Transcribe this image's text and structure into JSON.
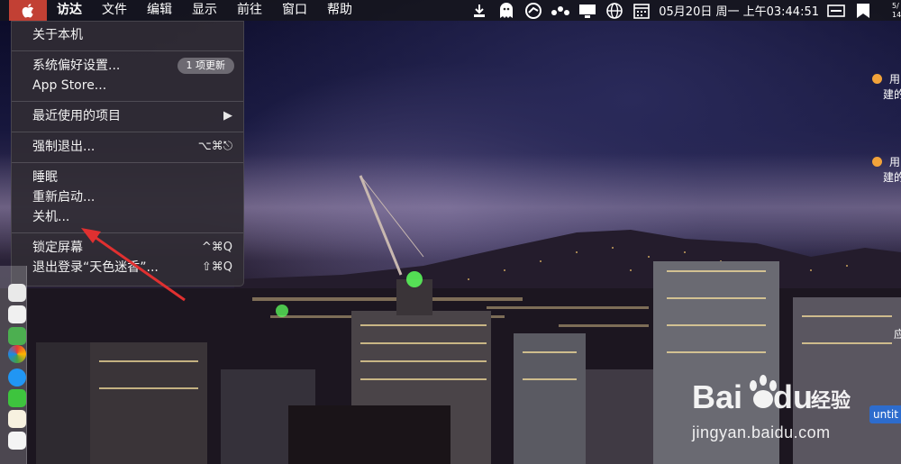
{
  "menubar": {
    "apple_icon": "apple-logo-icon",
    "items": [
      "访达",
      "文件",
      "编辑",
      "显示",
      "前往",
      "窗口",
      "帮助"
    ],
    "status_icons": [
      "download-icon",
      "ghost-icon",
      "sync-icon",
      "dots-icon",
      "display-icon",
      "globe-icon",
      "calendar-icon"
    ],
    "clock": "05月20日 周一 上午03:44:51",
    "trailing_icons": [
      "menu-bars-icon",
      "app-icon"
    ]
  },
  "apple_menu": {
    "about": "关于本机",
    "system_prefs": "系统偏好设置...",
    "system_prefs_badge": "1 项更新",
    "app_store": "App Store...",
    "recent_items": "最近使用的项目",
    "recent_items_arrow": "▶",
    "force_quit": "强制退出...",
    "force_quit_shortcut": "⌥⌘⎋",
    "sleep": "睡眠",
    "restart": "重新启动...",
    "shutdown": "关机...",
    "lock_screen": "锁定屏幕",
    "lock_screen_shortcut": "^⌘Q",
    "logout": "退出登录“天色迷香”...",
    "logout_shortcut": "⇧⌘Q"
  },
  "notifications": [
    {
      "line1": "用",
      "line2": "建的"
    },
    {
      "line1": "用",
      "line2": "建的"
    }
  ],
  "right_edge": {
    "top_text_1": "5/",
    "top_text_2": "14",
    "side_char": "应",
    "chip_label": "untit"
  },
  "watermark": {
    "brand_prefix": "Bai",
    "brand_suffix": "du",
    "brand_cn": "经验",
    "url": "jingyan.baidu.com"
  },
  "colors": {
    "apple_highlight": "#c24034",
    "menu_bg": "#302c34",
    "annotation_arrow": "#e03030",
    "notif_dot": "#f2a33a"
  }
}
